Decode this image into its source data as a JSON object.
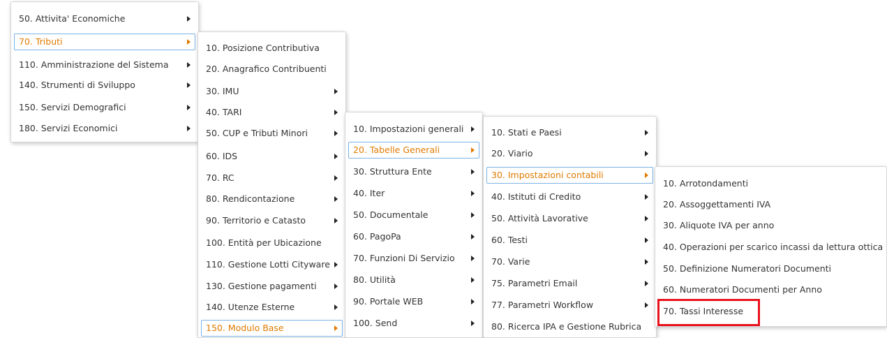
{
  "menus": [
    {
      "items": [
        {
          "label": "50. Attivita' Economiche",
          "submenu": true
        },
        {
          "label": "70. Tributi",
          "submenu": true,
          "active": true
        },
        {
          "label": "110. Amministrazione del Sistema",
          "submenu": true
        },
        {
          "label": "140. Strumenti di Sviluppo",
          "submenu": true
        },
        {
          "label": "150. Servizi Demografici",
          "submenu": true
        },
        {
          "label": "180. Servizi Economici",
          "submenu": true
        }
      ]
    },
    {
      "items": [
        {
          "label": "10. Posizione Contributiva",
          "submenu": false
        },
        {
          "label": "20. Anagrafico Contribuenti",
          "submenu": false
        },
        {
          "label": "30. IMU",
          "submenu": true
        },
        {
          "label": "40. TARI",
          "submenu": true
        },
        {
          "label": "50. CUP e Tributi Minori",
          "submenu": true
        },
        {
          "label": "60. IDS",
          "submenu": true
        },
        {
          "label": "70. RC",
          "submenu": true
        },
        {
          "label": "80. Rendicontazione",
          "submenu": true
        },
        {
          "label": "90. Territorio e Catasto",
          "submenu": true
        },
        {
          "label": "100. Entità per Ubicazione",
          "submenu": false
        },
        {
          "label": "110. Gestione Lotti Cityware",
          "submenu": true
        },
        {
          "label": "130. Gestione pagamenti",
          "submenu": true
        },
        {
          "label": "140. Utenze Esterne",
          "submenu": true
        },
        {
          "label": "150. Modulo Base",
          "submenu": true,
          "active": true
        }
      ]
    },
    {
      "items": [
        {
          "label": "10. Impostazioni generali",
          "submenu": true
        },
        {
          "label": "20. Tabelle Generali",
          "submenu": true,
          "active": true
        },
        {
          "label": "30. Struttura Ente",
          "submenu": true
        },
        {
          "label": "40. Iter",
          "submenu": true
        },
        {
          "label": "50. Documentale",
          "submenu": true
        },
        {
          "label": "60. PagoPa",
          "submenu": true
        },
        {
          "label": "70. Funzioni Di Servizio",
          "submenu": true
        },
        {
          "label": "80. Utilità",
          "submenu": true
        },
        {
          "label": "90. Portale WEB",
          "submenu": true
        },
        {
          "label": "100. Send",
          "submenu": true
        }
      ]
    },
    {
      "items": [
        {
          "label": "10. Stati e Paesi",
          "submenu": true
        },
        {
          "label": "20. Viario",
          "submenu": true
        },
        {
          "label": "30. Impostazioni contabili",
          "submenu": true,
          "active": true
        },
        {
          "label": "40. Istituti di Credito",
          "submenu": true
        },
        {
          "label": "50. Attività Lavorative",
          "submenu": true
        },
        {
          "label": "60. Testi",
          "submenu": true
        },
        {
          "label": "70. Varie",
          "submenu": true
        },
        {
          "label": "75. Parametri Email",
          "submenu": true
        },
        {
          "label": "77. Parametri Workflow",
          "submenu": true
        },
        {
          "label": "80. Ricerca IPA e Gestione Rubrica",
          "submenu": false
        }
      ]
    },
    {
      "items": [
        {
          "label": "10. Arrotondamenti",
          "submenu": false
        },
        {
          "label": "20. Assoggettamenti IVA",
          "submenu": false
        },
        {
          "label": "30. Aliquote IVA per anno",
          "submenu": false
        },
        {
          "label": "40. Operazioni per scarico incassi da lettura ottica",
          "submenu": false
        },
        {
          "label": "50. Definizione Numeratori Documenti",
          "submenu": false
        },
        {
          "label": "60. Numeratori Documenti per Anno",
          "submenu": false
        },
        {
          "label": "70. Tassi Interesse",
          "submenu": false,
          "highlighted": true
        }
      ]
    }
  ],
  "colors": {
    "active_text": "#e07b00",
    "active_border": "#7ab3e6",
    "highlight": "#e8121c"
  }
}
